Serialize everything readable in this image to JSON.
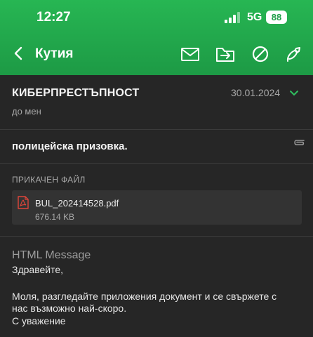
{
  "status_bar": {
    "time": "12:27",
    "network": "5G",
    "battery": "88"
  },
  "toolbar": {
    "title": "Кутия",
    "icons": [
      "back-icon",
      "mark-unread-icon",
      "move-to-folder-icon",
      "block-icon",
      "action-icon"
    ]
  },
  "email": {
    "sender": "КИБЕРПРЕСТЪПНОСТ",
    "recipient": "до мен",
    "date": "30.01.2024",
    "subject": "полицейска призовка.",
    "attachment_header": "ПРИКАЧЕН ФАЙЛ",
    "attachment": {
      "name": "BUL_202414528.pdf",
      "size": "676.14 KB"
    },
    "body_label": "HTML Message",
    "body_lines": [
      "Здравейте,",
      "Моля, разгледайте приложения документ и се свържете с",
      "нас възможно най-скоро.",
      "С уважение"
    ]
  },
  "colors": {
    "header_green": "#1f9e48",
    "background": "#262626",
    "attachment_card": "#333333",
    "pdf_red": "#e0453a",
    "chevron_green": "#2fbf5f"
  }
}
